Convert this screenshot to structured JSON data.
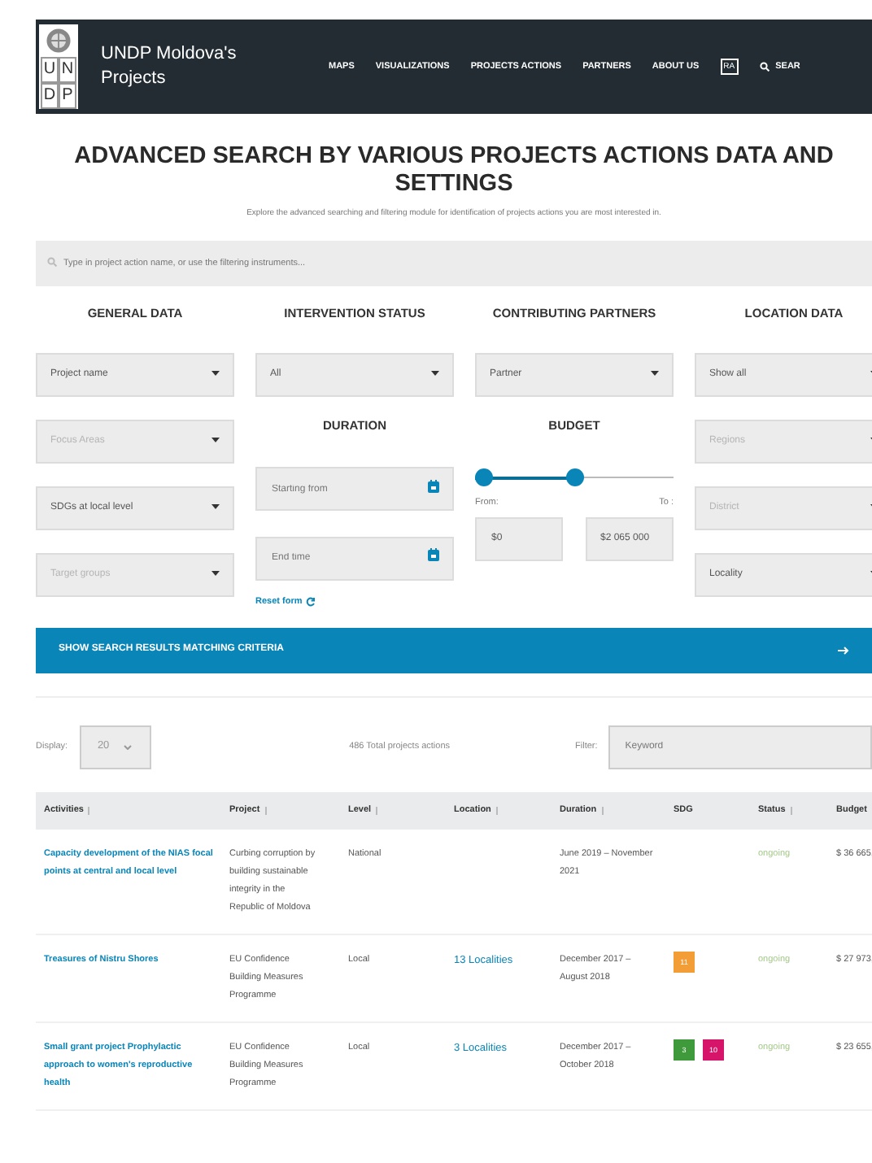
{
  "header": {
    "logo_letters": [
      "U",
      "N",
      "D",
      "P"
    ],
    "title": "UNDP Moldova's Projects",
    "nav": [
      "MAPS",
      "VISUALIZATIONS",
      "PROJECTS ACTIONS",
      "PARTNERS",
      "ABOUT US"
    ],
    "lang_label": "RA",
    "search_label": "SEAR"
  },
  "page": {
    "title": "ADVANCED SEARCH BY VARIOUS PROJECTS ACTIONS DATA AND SETTINGS",
    "subtitle": "Explore the advanced searching and filtering module for identification of projects actions you are most interested in.",
    "search": {
      "placeholder": "Type in project action name, or use the filtering instruments..."
    }
  },
  "filters": {
    "general": {
      "title": "GENERAL DATA",
      "fields": [
        {
          "label": "Project name",
          "disabled": false
        },
        {
          "label": "Focus Areas",
          "disabled": true
        },
        {
          "label": "SDGs at local level",
          "disabled": false
        },
        {
          "label": "Target groups",
          "disabled": true
        }
      ]
    },
    "status": {
      "title": "INTERVENTION STATUS",
      "field": {
        "label": "All",
        "disabled": false
      }
    },
    "partners": {
      "title": "CONTRIBUTING PARTNERS",
      "field": {
        "label": "Partner",
        "disabled": false
      }
    },
    "duration": {
      "title": "DURATION",
      "fields": [
        {
          "placeholder": "Starting from"
        },
        {
          "placeholder": "End time"
        }
      ]
    },
    "budget": {
      "title": "BUDGET",
      "thumbs": [
        {
          "level": 0
        },
        {
          "level": 0.5
        }
      ],
      "from_label": "From:",
      "to_label": "To :",
      "from_value": "$0",
      "to_value": "$2 065 000"
    },
    "reset": "Reset form",
    "location": {
      "title": "LOCATION DATA",
      "fields": [
        {
          "label": "Show all",
          "disabled": false
        },
        {
          "label": "Regions",
          "disabled": true
        },
        {
          "label": "District",
          "disabled": true
        },
        {
          "label": "Locality",
          "disabled": false
        }
      ]
    }
  },
  "submit": "SHOW SEARCH RESULTS MATCHING CRITERIA",
  "results": {
    "display_label": "Display:",
    "display_value": "20",
    "total": "486 Total projects actions",
    "filter_label": "Filter:",
    "filter_placeholder": "Keyword"
  },
  "table": {
    "columns": [
      "Activities",
      "Project",
      "Level",
      "Location",
      "Duration",
      "SDG",
      "Status",
      "Budget"
    ],
    "rows": [
      {
        "activity": "Capacity development of the NIAS focal points at central and local level",
        "project": "Curbing corruption by building sustainable integrity in the Republic of Moldova",
        "level": "National",
        "location": "",
        "duration": "June 2019 – November 2021",
        "sdg": [],
        "status": "ongoing",
        "budget": "$ 36 665,"
      },
      {
        "activity": "Treasures of Nistru Shores",
        "project": "EU Confidence Building Measures Programme",
        "level": "Local",
        "location": "13 Localities",
        "duration": "December 2017 – August 2018",
        "sdg": [
          {
            "label": "11",
            "color": "#f39d37"
          }
        ],
        "status": "ongoing",
        "budget": "$ 27 973,"
      },
      {
        "activity": "Small grant project Prophylactic approach to women's reproductive health",
        "project": "EU Confidence Building Measures Programme",
        "level": "Local",
        "location": "3 Localities",
        "duration": "December 2017 – October 2018",
        "sdg": [
          {
            "label": "3",
            "color": "#3f9a3c"
          },
          {
            "label": "10",
            "color": "#d6156a"
          }
        ],
        "status": "ongoing",
        "budget": "$ 23 655,"
      }
    ]
  }
}
